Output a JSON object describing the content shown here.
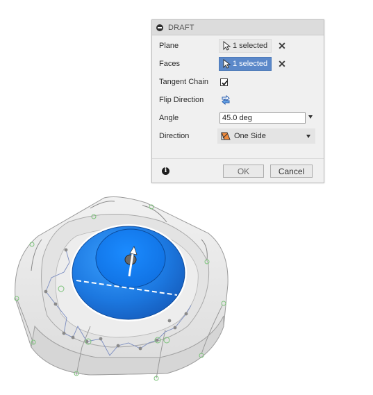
{
  "dialog": {
    "title": "DRAFT",
    "rows": {
      "plane": {
        "label": "Plane",
        "value": "1 selected"
      },
      "faces": {
        "label": "Faces",
        "value": "1 selected"
      },
      "tangent_chain": {
        "label": "Tangent Chain",
        "checked": true
      },
      "flip_direction": {
        "label": "Flip Direction"
      },
      "angle": {
        "label": "Angle",
        "value": "45.0 deg"
      },
      "direction": {
        "label": "Direction",
        "value": "One Side"
      }
    },
    "ok_label": "OK",
    "cancel_label": "Cancel",
    "info_icon": "i"
  },
  "icons": {
    "collapse": "minus-circle-icon",
    "select_cursor": "cursor-arrow-icon",
    "clear": "close-x-icon",
    "flip": "flip-direction-icon",
    "one_side": "one-side-draft-icon",
    "info": "info-icon"
  },
  "colors": {
    "selection_active": "#5b88c9",
    "selected_face": "#1f7fe8",
    "model_body": "#e6e6e6"
  }
}
